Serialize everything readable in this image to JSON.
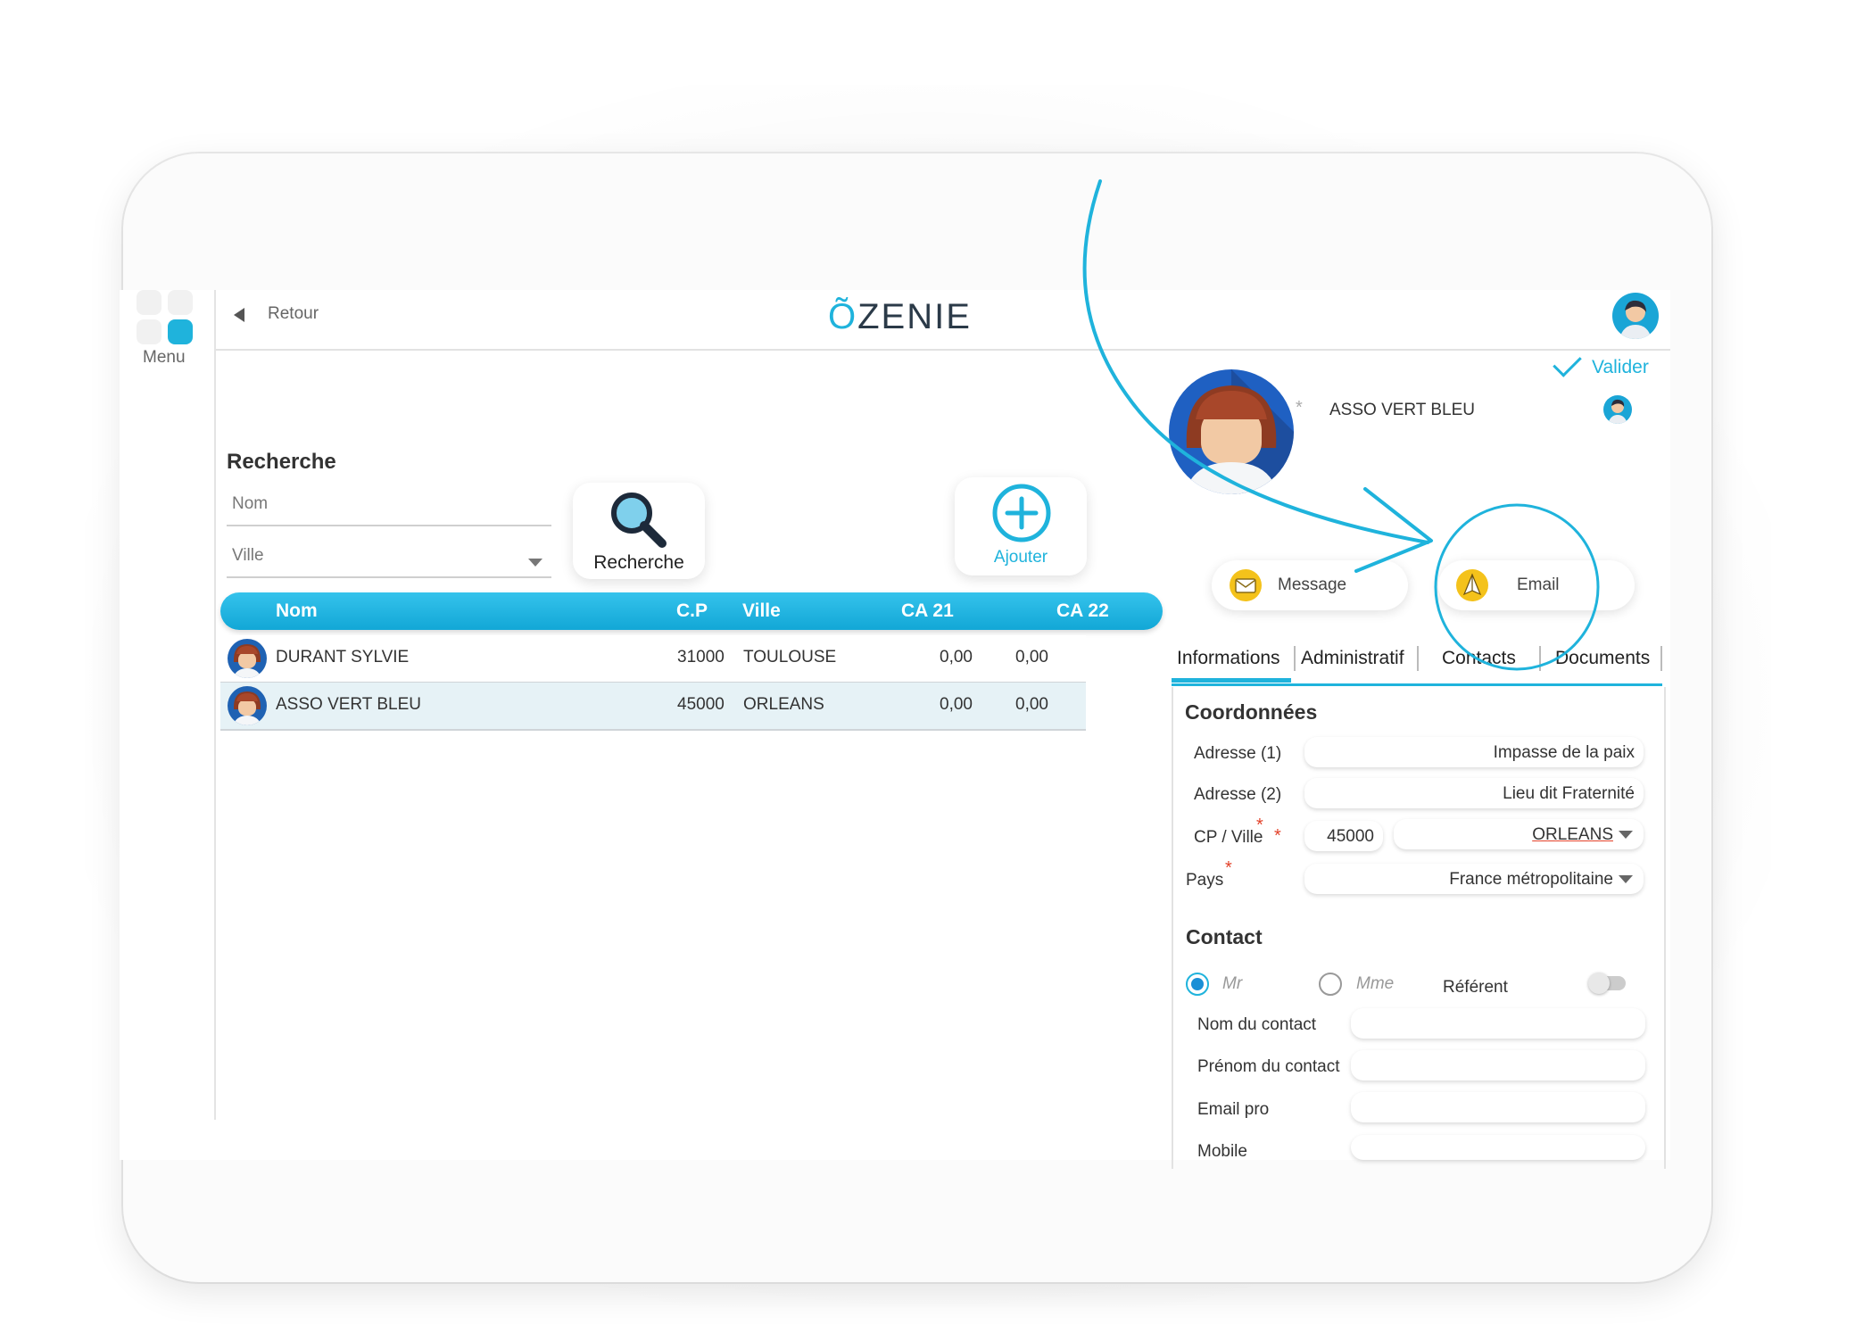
{
  "nav": {
    "menu_label": "Menu",
    "back_label": "Retour",
    "logo_prefix": "Õ",
    "logo_text": "ZENIE"
  },
  "search": {
    "title": "Recherche",
    "nom_placeholder": "Nom",
    "ville_placeholder": "Ville",
    "search_button": "Recherche",
    "add_button": "Ajouter"
  },
  "table": {
    "headers": {
      "nom": "Nom",
      "cp": "C.P",
      "ville": "Ville",
      "ca21": "CA 21",
      "ca22": "CA 22"
    },
    "rows": [
      {
        "nom": "DURANT SYLVIE",
        "cp": "31000",
        "ville": "TOULOUSE",
        "ca21": "0,00",
        "ca22": "0,00"
      },
      {
        "nom": "ASSO VERT BLEU",
        "cp": "45000",
        "ville": "ORLEANS",
        "ca21": "0,00",
        "ca22": "0,00",
        "selected": true
      }
    ]
  },
  "detail": {
    "valider_label": "Valider",
    "client_name": "ASSO VERT BLEU",
    "star": "*",
    "message_button": "Message",
    "email_button": "Email",
    "tabs": [
      "Informations",
      "Administratif",
      "Contacts",
      "Documents"
    ],
    "active_tab": "Informations",
    "coordonnees": {
      "title": "Coordonnées",
      "adresse1_label": "Adresse (1)",
      "adresse1_value": "Impasse de la paix",
      "adresse2_label": "Adresse (2)",
      "adresse2_value": "Lieu dit Fraternité",
      "cpville_label": "CP / Ville",
      "cp_value": "45000",
      "ville_value": "ORLEANS",
      "pays_label": "Pays",
      "pays_value": "France métropolitaine",
      "required_mark": "*"
    },
    "contact": {
      "title": "Contact",
      "civ_mr": "Mr",
      "civ_mme": "Mme",
      "selected_civ": "Mr",
      "referent_label": "Référent",
      "referent_on": false,
      "nom_label": "Nom du contact",
      "prenom_label": "Prénom du contact",
      "email_label": "Email pro",
      "mobile_label": "Mobile"
    }
  },
  "colors": {
    "accent": "#1fb3dc",
    "header_gradient_top": "#35c3ec",
    "header_gradient_bottom": "#12a7d6",
    "selected_row": "#e6f2f6",
    "required": "#e2422a"
  }
}
